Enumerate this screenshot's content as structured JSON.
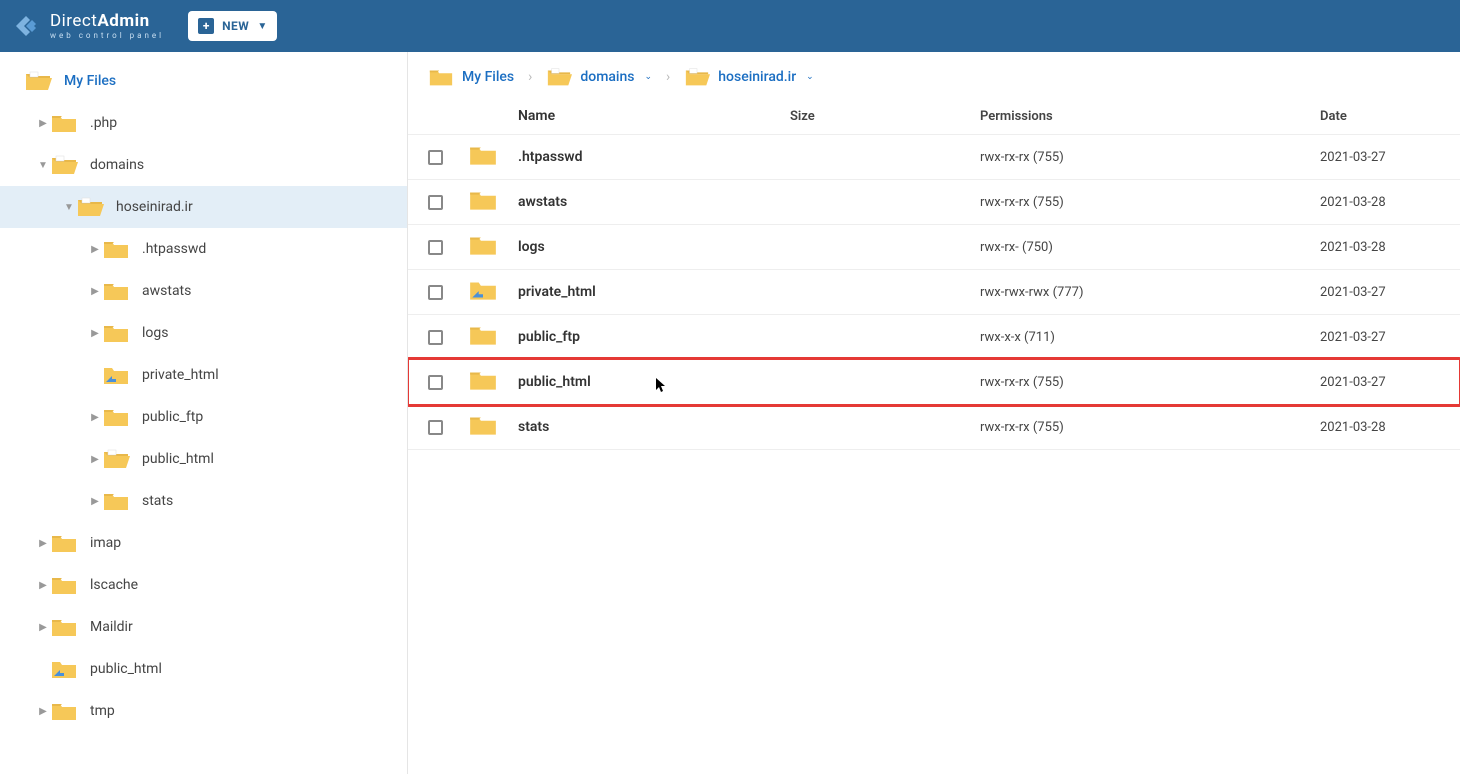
{
  "header": {
    "brand_main": "Direct",
    "brand_bold": "Admin",
    "brand_sub": "web control panel",
    "new_button": "NEW"
  },
  "sidebar": {
    "root_label": "My Files",
    "items": [
      {
        "label": ".php",
        "depth": 1,
        "arrow": "▶",
        "type": "folder"
      },
      {
        "label": "domains",
        "depth": 1,
        "arrow": "▼",
        "type": "folder-open"
      },
      {
        "label": "hoseinirad.ir",
        "depth": 2,
        "arrow": "▼",
        "type": "folder-open",
        "selected": true
      },
      {
        "label": ".htpasswd",
        "depth": 3,
        "arrow": "▶",
        "type": "folder"
      },
      {
        "label": "awstats",
        "depth": 3,
        "arrow": "▶",
        "type": "folder"
      },
      {
        "label": "logs",
        "depth": 3,
        "arrow": "▶",
        "type": "folder"
      },
      {
        "label": "private_html",
        "depth": 3,
        "arrow": "",
        "type": "folder-link"
      },
      {
        "label": "public_ftp",
        "depth": 3,
        "arrow": "▶",
        "type": "folder"
      },
      {
        "label": "public_html",
        "depth": 3,
        "arrow": "▶",
        "type": "folder-open"
      },
      {
        "label": "stats",
        "depth": 3,
        "arrow": "▶",
        "type": "folder"
      },
      {
        "label": "imap",
        "depth": 1,
        "arrow": "▶",
        "type": "folder"
      },
      {
        "label": "lscache",
        "depth": 1,
        "arrow": "▶",
        "type": "folder"
      },
      {
        "label": "Maildir",
        "depth": 1,
        "arrow": "▶",
        "type": "folder"
      },
      {
        "label": "public_html",
        "depth": 1,
        "arrow": "",
        "type": "folder-link"
      },
      {
        "label": "tmp",
        "depth": 1,
        "arrow": "▶",
        "type": "folder"
      }
    ]
  },
  "breadcrumb": [
    {
      "label": "My Files",
      "type": "folder",
      "caret": false
    },
    {
      "label": "domains",
      "type": "folder-open",
      "caret": true
    },
    {
      "label": "hoseinirad.ir",
      "type": "folder-open",
      "caret": true
    }
  ],
  "columns": {
    "name": "Name",
    "size": "Size",
    "permissions": "Permissions",
    "date": "Date"
  },
  "rows": [
    {
      "name": ".htpasswd",
      "size": "",
      "perm": "rwx-rx-rx (755)",
      "date": "2021-03-27",
      "type": "folder"
    },
    {
      "name": "awstats",
      "size": "",
      "perm": "rwx-rx-rx (755)",
      "date": "2021-03-28",
      "type": "folder"
    },
    {
      "name": "logs",
      "size": "",
      "perm": "rwx-rx- (750)",
      "date": "2021-03-28",
      "type": "folder"
    },
    {
      "name": "private_html",
      "size": "",
      "perm": "rwx-rwx-rwx (777)",
      "date": "2021-03-27",
      "type": "folder-link"
    },
    {
      "name": "public_ftp",
      "size": "",
      "perm": "rwx-x-x (711)",
      "date": "2021-03-27",
      "type": "folder"
    },
    {
      "name": "public_html",
      "size": "",
      "perm": "rwx-rx-rx (755)",
      "date": "2021-03-27",
      "type": "folder",
      "highlighted": true,
      "cursor": true
    },
    {
      "name": "stats",
      "size": "",
      "perm": "rwx-rx-rx (755)",
      "date": "2021-03-28",
      "type": "folder"
    }
  ]
}
